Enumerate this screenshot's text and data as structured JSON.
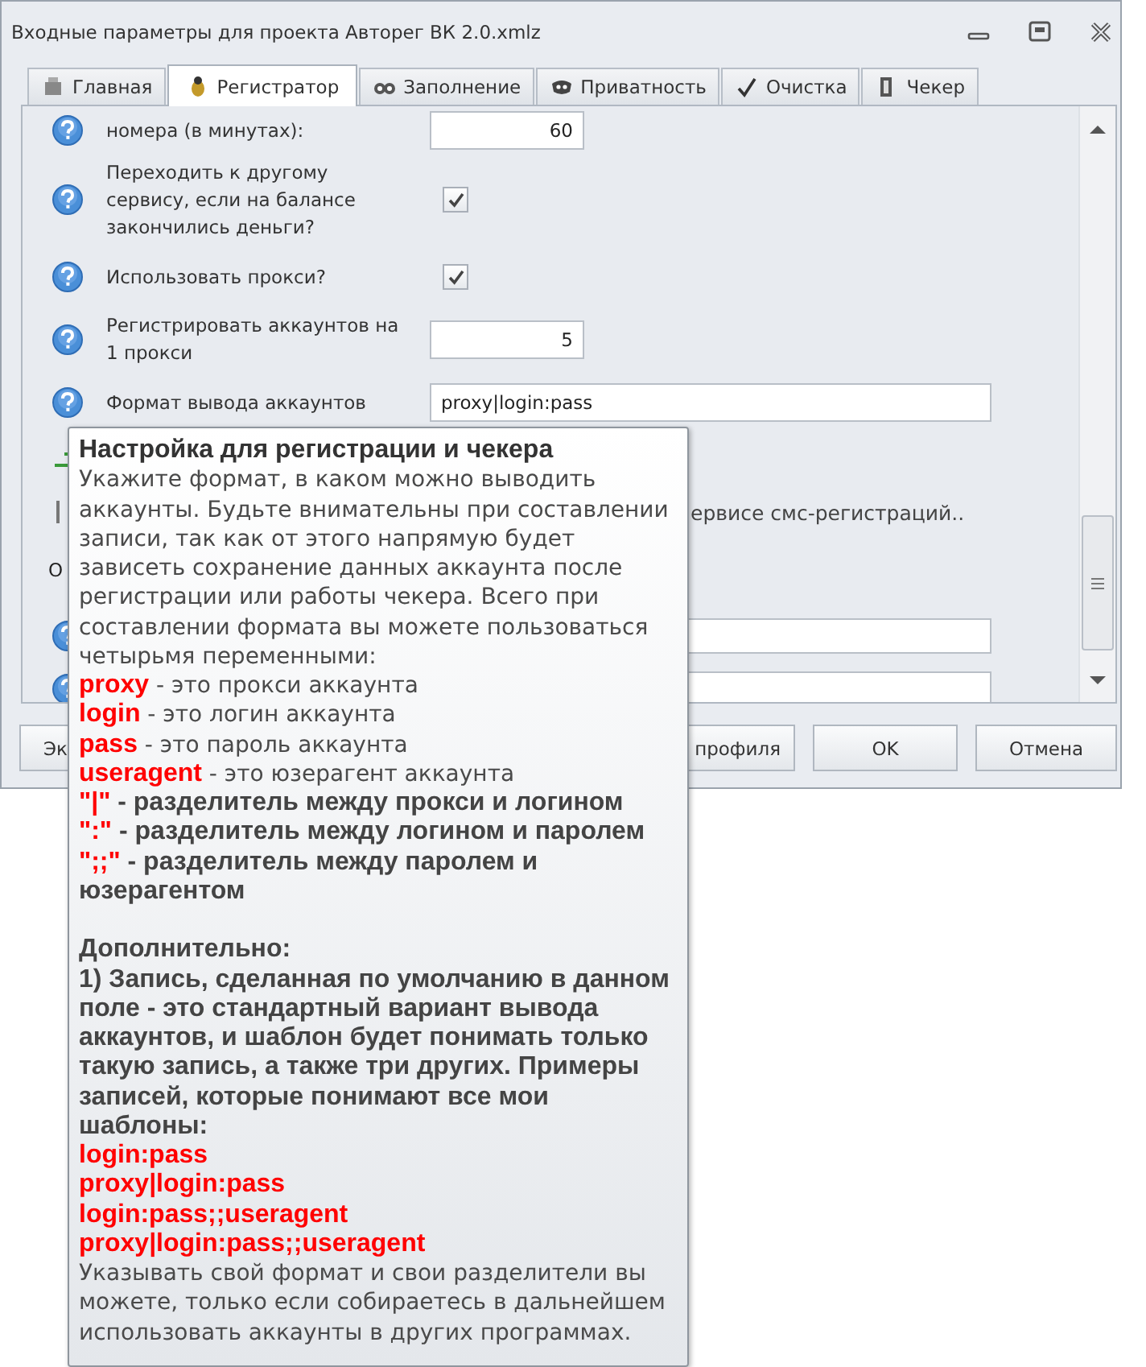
{
  "window": {
    "title": "Входные параметры для проекта Авторег ВК 2.0.xmlz"
  },
  "tabs": [
    {
      "label": "Главная",
      "selected": false
    },
    {
      "label": "Регистратор",
      "selected": true
    },
    {
      "label": "Заполнение",
      "selected": false
    },
    {
      "label": "Приватность",
      "selected": false
    },
    {
      "label": "Очистка",
      "selected": false
    },
    {
      "label": "Чекер",
      "selected": false
    }
  ],
  "settings": [
    {
      "kind": "number",
      "label": "номера (в минутах):",
      "value": "60"
    },
    {
      "kind": "checkbox",
      "label": "Переходить к другому сервису, если на балансе закончились деньги?",
      "checked": true
    },
    {
      "kind": "checkbox",
      "label": "Использовать прокси?",
      "checked": true
    },
    {
      "kind": "number",
      "label": "Регистрировать аккаунтов на 1 прокси",
      "value": "5"
    },
    {
      "kind": "text",
      "label": "Формат вывода аккаунтов",
      "value": "proxy|login:pass"
    }
  ],
  "hidden_note": "ервисе смс-регистраций..",
  "section_label": "О",
  "buttons": [
    "Эк",
    "профиля",
    "OK",
    "Отмена"
  ],
  "tooltip": {
    "title": "Настройка для регистрации и чекера",
    "intro": "Укажите формат, в каком можно выводить аккаунты. Будьте внимательны при составлении записи, так как от этого напрямую будет зависеть сохранение данных аккаунта после регистрации или работы чекера. Всего при составлении формата вы можете пользоваться четырьмя переменными:",
    "variables": [
      {
        "name": "proxy",
        "text": " - это прокси аккаунта"
      },
      {
        "name": "login",
        "text": " - это логин аккаунта"
      },
      {
        "name": "pass",
        "text": " - это пароль аккаунта"
      },
      {
        "name": "useragent",
        "text": " - это юзерагент аккаунта"
      }
    ],
    "separators": [
      {
        "name": "\"|\"",
        "text": " - разделитель между прокси и логином"
      },
      {
        "name": "\":\"",
        "text": " - разделитель между логином и паролем"
      },
      {
        "name": "\";;\"",
        "text": " - разделитель между паролем и юзерагентом"
      }
    ],
    "extra_heading": "Дополнительно:",
    "extra": "1) Запись, сделанная по умолчанию в данном поле - это стандартный вариант вывода аккаунтов, и шаблон будет понимать только такую запись, а также три других. Примеры записей, которые понимают все мои шаблоны:",
    "examples": [
      "login:pass",
      "proxy|login:pass",
      "login:pass;;useragent",
      "proxy|login:pass;;useragent"
    ],
    "footer": "Указывать свой формат и свои разделители вы можете, только если собираетесь в дальнейшем использовать аккаунты в других программах."
  }
}
